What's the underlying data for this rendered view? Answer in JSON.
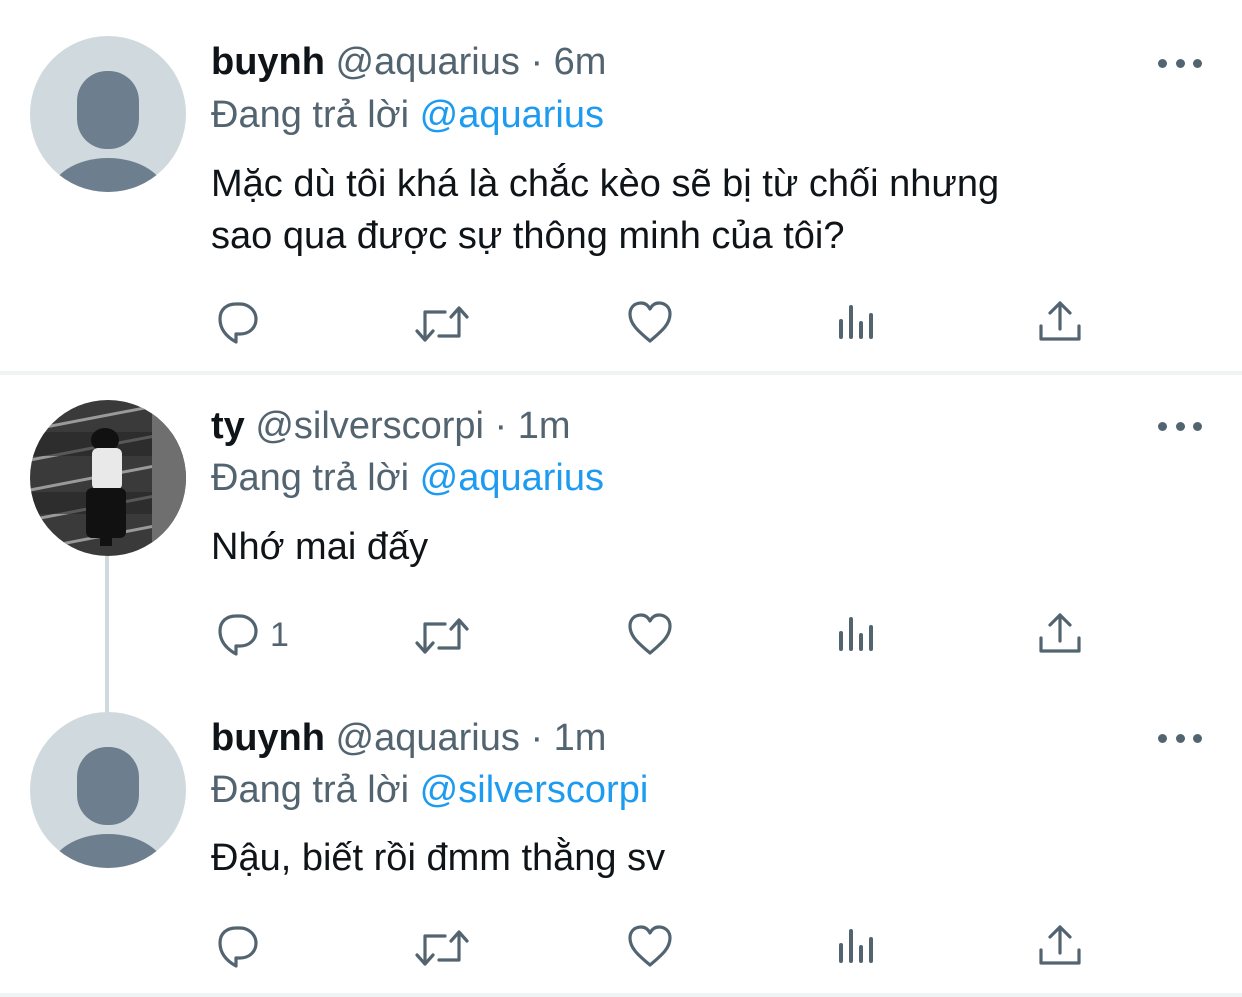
{
  "colors": {
    "text": "#0f1419",
    "muted": "#536471",
    "link": "#1d9bf0",
    "divider": "#eff3f4",
    "thread_line": "#cfd9de"
  },
  "icons": {
    "reply": "reply-icon",
    "retweet": "retweet-icon",
    "like": "heart-icon",
    "views": "analytics-icon",
    "share": "share-icon",
    "more": "more-icon",
    "avatar_default": "default-avatar"
  },
  "tweets": [
    {
      "name": "buynh",
      "handle": "@aquarius",
      "sep": "·",
      "time": "6m",
      "replying_prefix": "Đang trả lời",
      "replying_to": "@aquarius",
      "text_line1": "Mặc dù tôi khá là chắc kèo sẽ bị từ chối nhưng",
      "text_line2": "sao qua được sự thông minh của tôi?",
      "reply_count": ""
    },
    {
      "name": "ty",
      "handle": "@silverscorpi",
      "sep": "·",
      "time": "1m",
      "replying_prefix": "Đang trả lời",
      "replying_to": "@aquarius",
      "text_line1": "Nhớ mai đấy",
      "reply_count": "1"
    },
    {
      "name": "buynh",
      "handle": "@aquarius",
      "sep": "·",
      "time": "1m",
      "replying_prefix": "Đang trả lời",
      "replying_to": "@silverscorpi",
      "text_line1": "Đậu, biết rồi đmm thằng sv",
      "reply_count": ""
    }
  ]
}
